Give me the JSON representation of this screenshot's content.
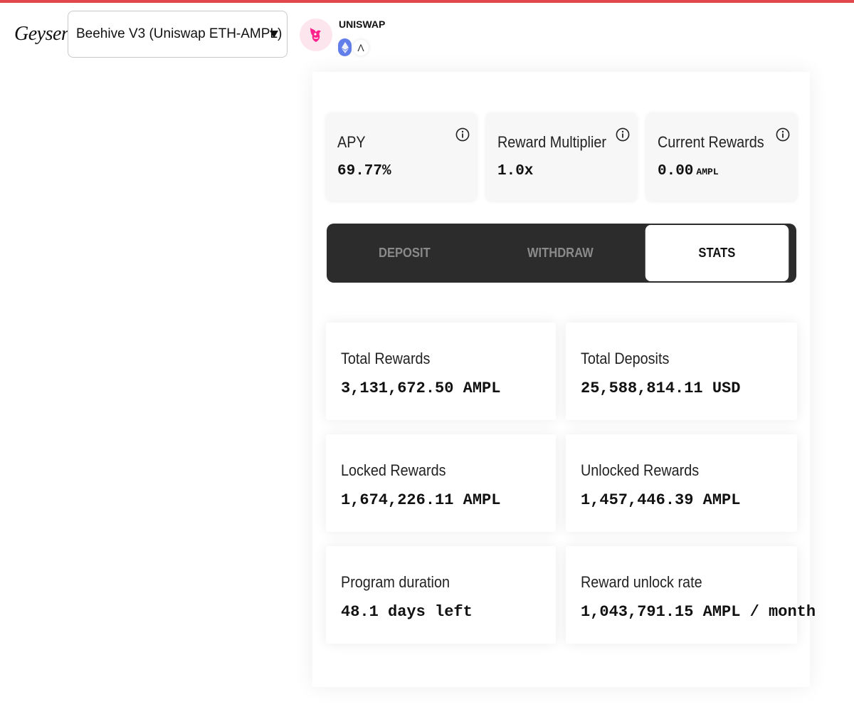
{
  "header": {
    "app_label": "Geyser",
    "selected_geyser": "Beehive V3 (Uniswap ETH-AMPL)",
    "platform": "UNISWAP",
    "ampl_symbol": "Λ"
  },
  "metrics": [
    {
      "label": "APY",
      "value": "69.77%",
      "unit": ""
    },
    {
      "label": "Reward Multiplier",
      "value": "1.0x",
      "unit": ""
    },
    {
      "label": "Current Rewards",
      "value": "0.00",
      "unit": "AMPL"
    }
  ],
  "tabs": [
    {
      "label": "DEPOSIT",
      "active": false
    },
    {
      "label": "WITHDRAW",
      "active": false
    },
    {
      "label": "STATS",
      "active": true
    }
  ],
  "stats": [
    {
      "label": "Total Rewards",
      "value": "3,131,672.50 AMPL"
    },
    {
      "label": "Total Deposits",
      "value": "25,588,814.11 USD"
    },
    {
      "label": "Locked Rewards",
      "value": "1,674,226.11 AMPL"
    },
    {
      "label": "Unlocked Rewards",
      "value": "1,457,446.39 AMPL"
    },
    {
      "label": "Program duration",
      "value": "48.1 days left"
    },
    {
      "label": "Reward unlock rate",
      "value": "1,043,791.15 AMPL / month"
    }
  ],
  "colors": {
    "accent_bar": "#e2474b",
    "tab_background": "#2c2c2c",
    "uniswap_pink": "#ff007a",
    "eth_blue": "#627eea"
  }
}
